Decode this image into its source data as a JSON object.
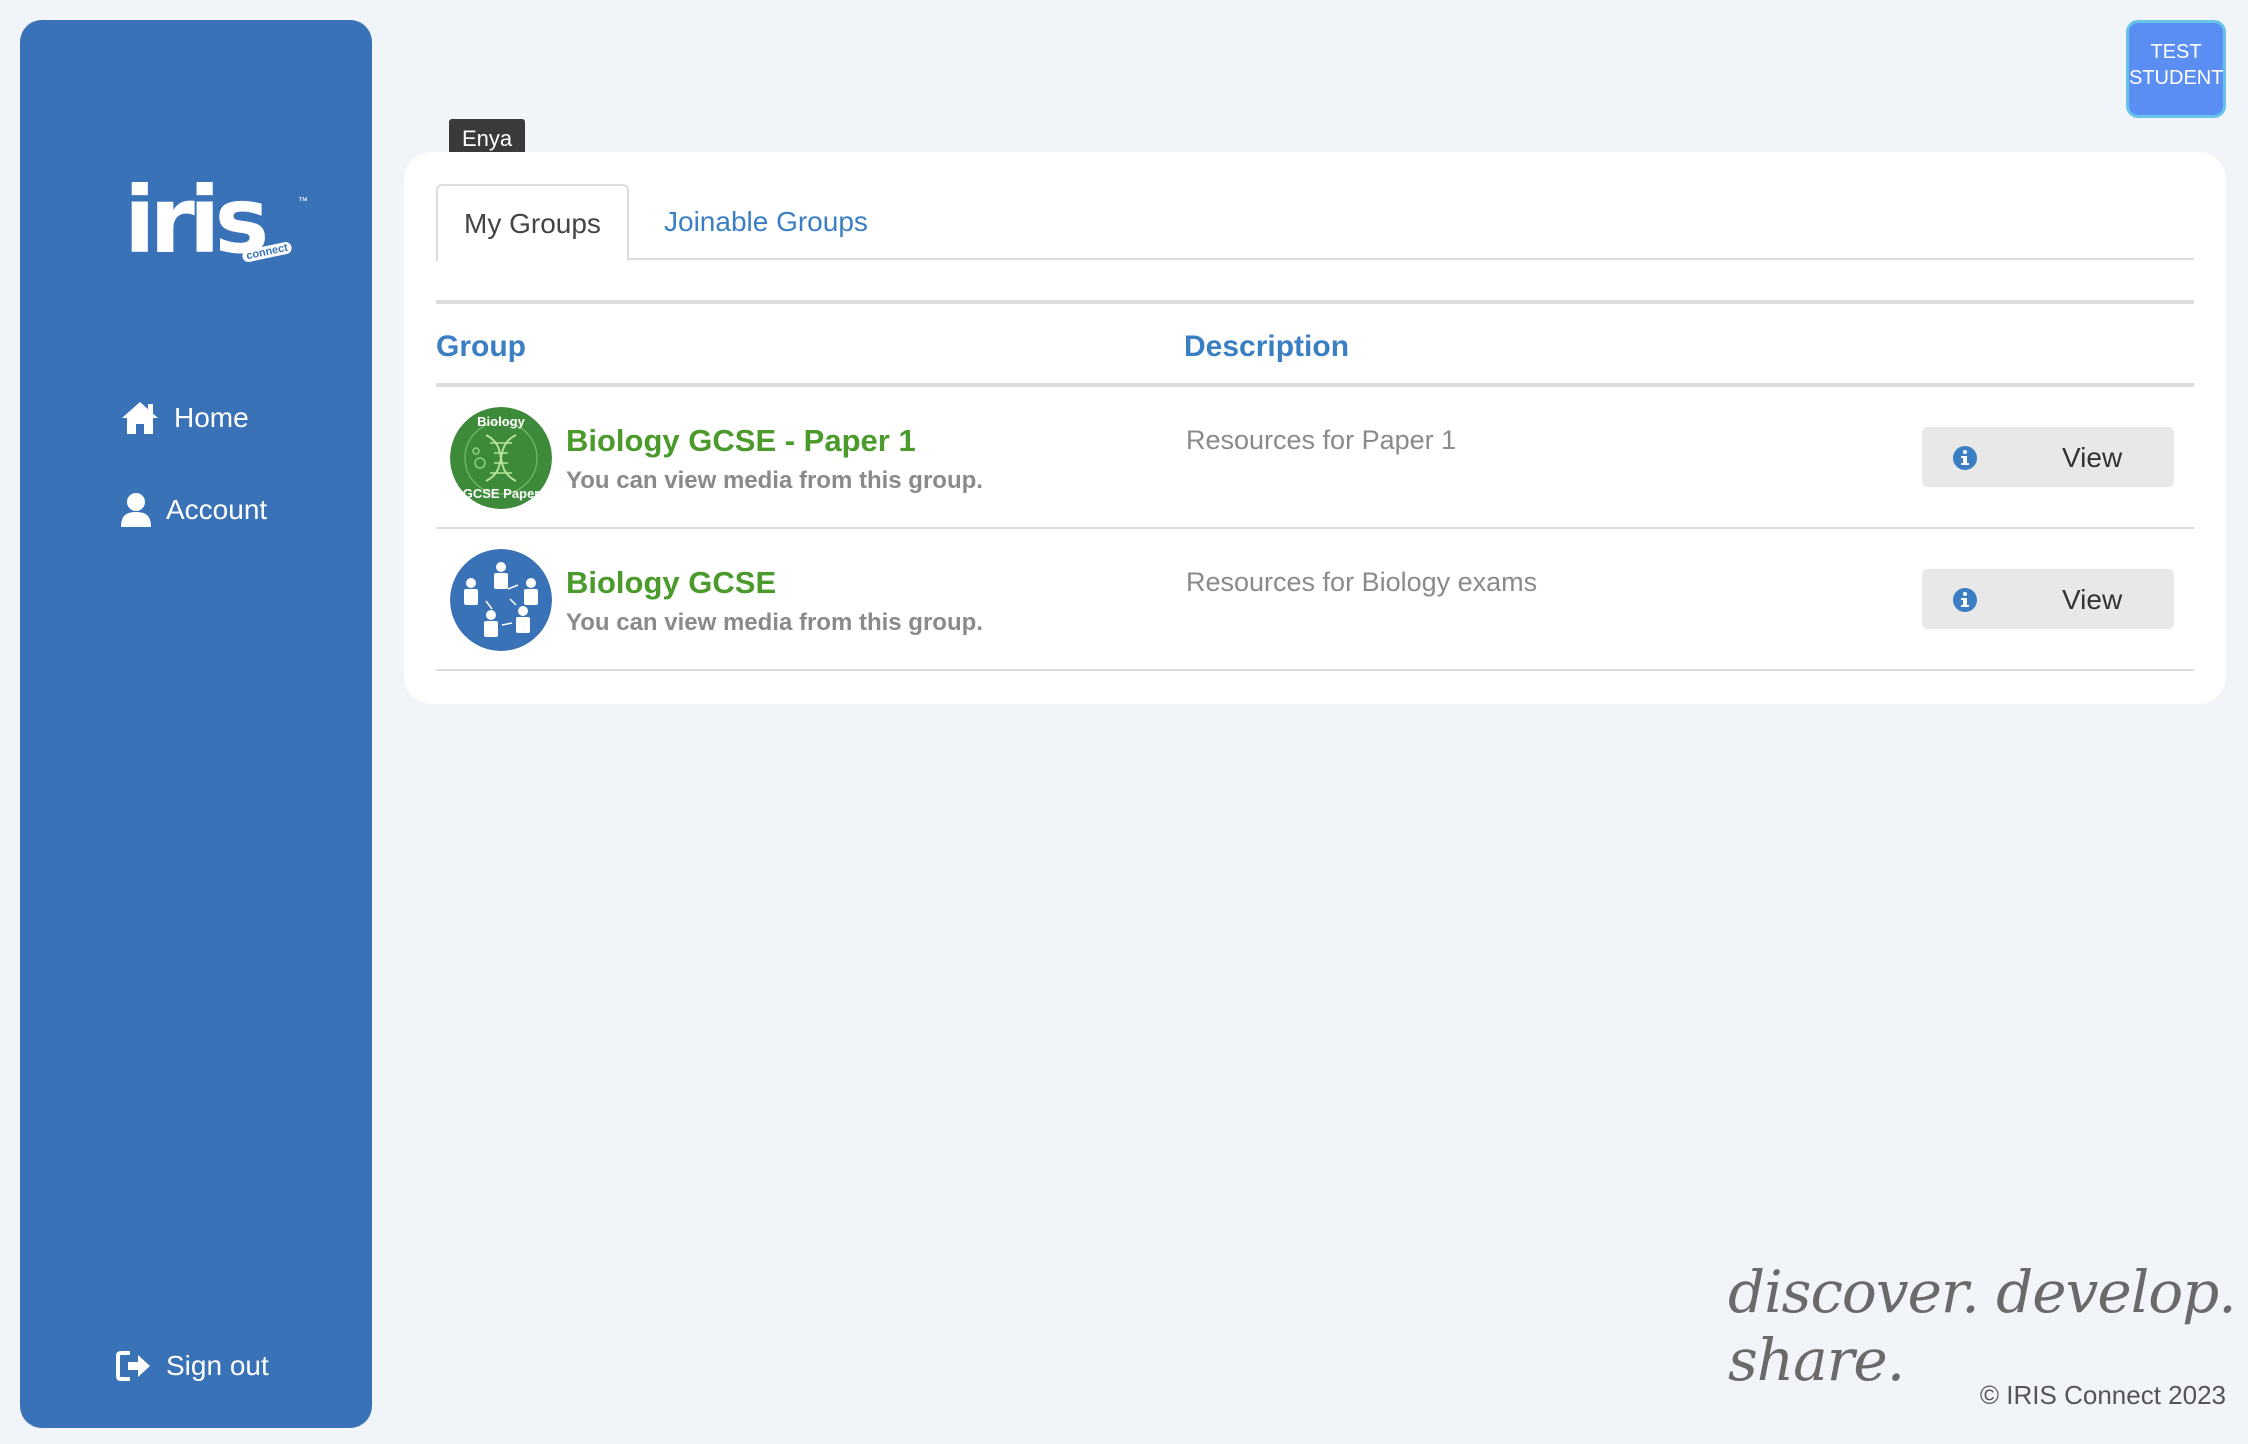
{
  "sidebar": {
    "logo": {
      "text": "iris",
      "subtext": "connect"
    },
    "nav": {
      "home": "Home",
      "account": "Account",
      "signout": "Sign out"
    }
  },
  "user_badge": {
    "line1": "TEST",
    "line2": "STUDENT"
  },
  "tooltip": {
    "text": "Enya"
  },
  "tabs": {
    "my_groups": "My Groups",
    "joinable_groups": "Joinable Groups"
  },
  "table": {
    "headers": {
      "group": "Group",
      "description": "Description"
    },
    "rows": [
      {
        "name": "Biology GCSE - Paper 1",
        "subtitle": "You can view media from this group.",
        "description": "Resources for Paper 1",
        "button": "View",
        "avatar": {
          "type": "biology-paper",
          "top_text": "Biology",
          "bottom_text": "GCSE Paper",
          "color": "#3d8a3a"
        }
      },
      {
        "name": "Biology GCSE",
        "subtitle": "You can view media from this group.",
        "description": "Resources for Biology exams",
        "button": "View",
        "avatar": {
          "type": "people-network",
          "color": "#3a72b8"
        }
      }
    ]
  },
  "footer": {
    "tagline": "discover. develop. share.",
    "copyright": "© IRIS Connect 2023"
  },
  "colors": {
    "sidebar": "#3a72b8",
    "accent_blue": "#3a7fc4",
    "group_green": "#4a9a2c",
    "badge": "#5b8ef3"
  }
}
